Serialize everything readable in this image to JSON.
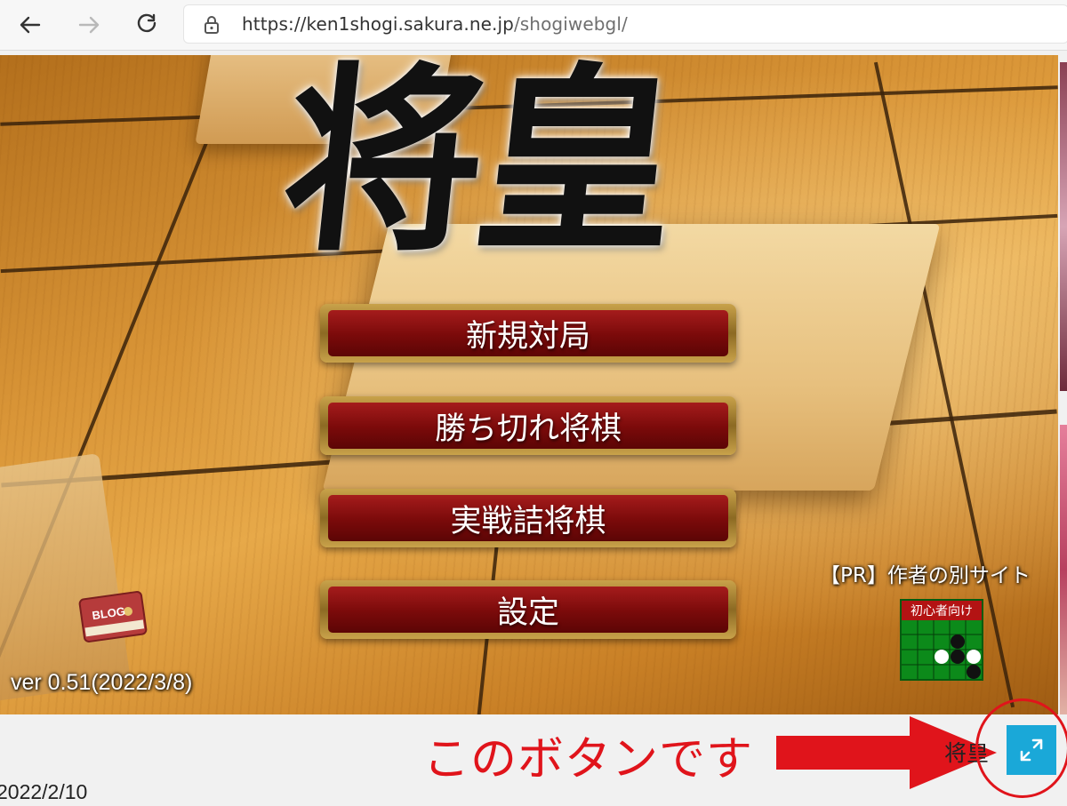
{
  "browser": {
    "url_host": "https://ken1shogi.sakura.ne.jp",
    "url_path": "/shogiwebgl/",
    "back_icon": "arrow-left-icon",
    "forward_icon": "arrow-right-icon",
    "reload_icon": "reload-icon",
    "lock_icon": "lock-icon"
  },
  "game": {
    "logo": "将皇",
    "menu": [
      {
        "label": "新規対局"
      },
      {
        "label": "勝ち切れ将棋"
      },
      {
        "label": "実戦詰将棋"
      },
      {
        "label": "設定"
      }
    ],
    "blog_label": "BLOG",
    "version": "ver 0.51(2022/3/8)",
    "pr_text": "【PR】作者の別サイト",
    "othello_label": "初心者向け"
  },
  "bottom": {
    "date": "2022/2/10",
    "annotation": "このボタンです",
    "site_name": "将皇",
    "fullscreen_icon": "expand-icon"
  },
  "colors": {
    "annotation": "#e0141b",
    "fullscreen_button": "#1aa8d8",
    "menu_button": "#7a0a0a"
  }
}
